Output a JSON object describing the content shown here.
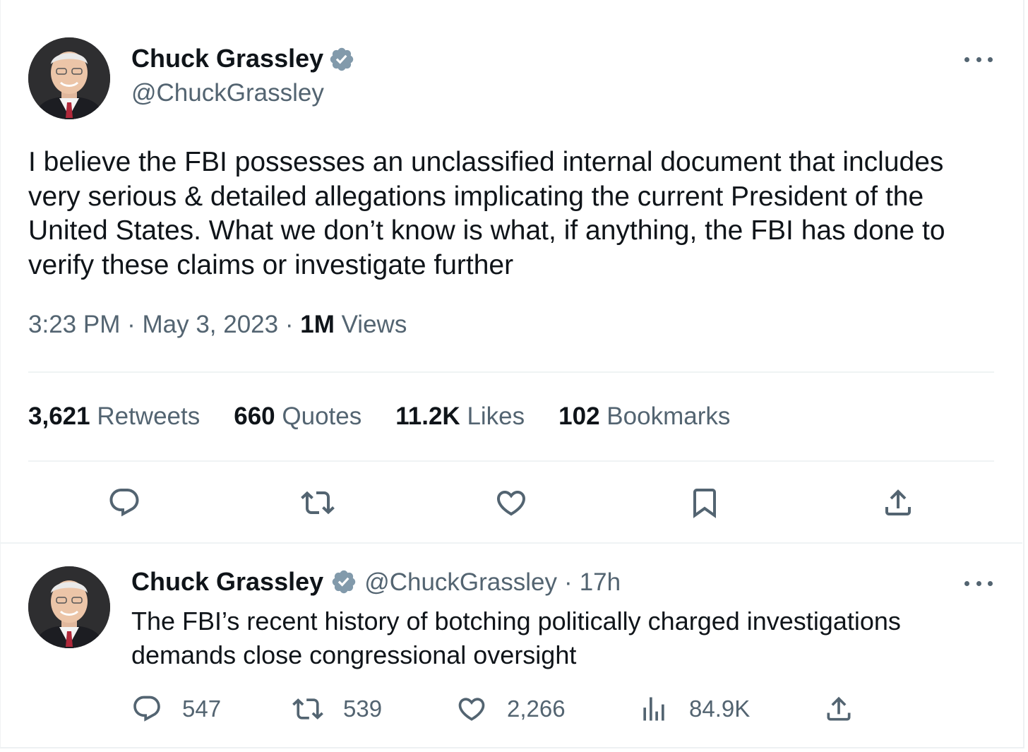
{
  "main_tweet": {
    "author": {
      "name": "Chuck Grassley",
      "handle": "@ChuckGrassley",
      "avatar_icon": "profile-photo",
      "verified_icon": "verified-badge-icon"
    },
    "text": "I believe the FBI possesses an unclassified internal document that includes very serious & detailed allegations implicating the current President of the United States. What we don’t know is what, if anything, the FBI has done to verify these claims or investigate further",
    "time": "3:23 PM",
    "date": "May 3, 2023",
    "separator": "·",
    "views_count": "1M",
    "views_label": "Views",
    "stats": {
      "retweets_count": "3,621",
      "retweets_label": "Retweets",
      "quotes_count": "660",
      "quotes_label": "Quotes",
      "likes_count": "11.2K",
      "likes_label": "Likes",
      "bookmarks_count": "102",
      "bookmarks_label": "Bookmarks"
    },
    "actions": [
      "reply-icon",
      "retweet-icon",
      "like-icon",
      "bookmark-icon",
      "share-icon"
    ]
  },
  "reply_tweet": {
    "author": {
      "name": "Chuck Grassley",
      "handle": "@ChuckGrassley",
      "separator": "·",
      "age": "17h"
    },
    "text": "The FBI’s recent history of botching politically charged investigations demands close congressional oversight",
    "reply_count": "547",
    "retweet_count": "539",
    "like_count": "2,266",
    "views_count": "84.9K"
  },
  "colors": {
    "text": "#0f1419",
    "secondary": "#536471",
    "verified": "#829aab",
    "divider": "#eff3f4"
  }
}
